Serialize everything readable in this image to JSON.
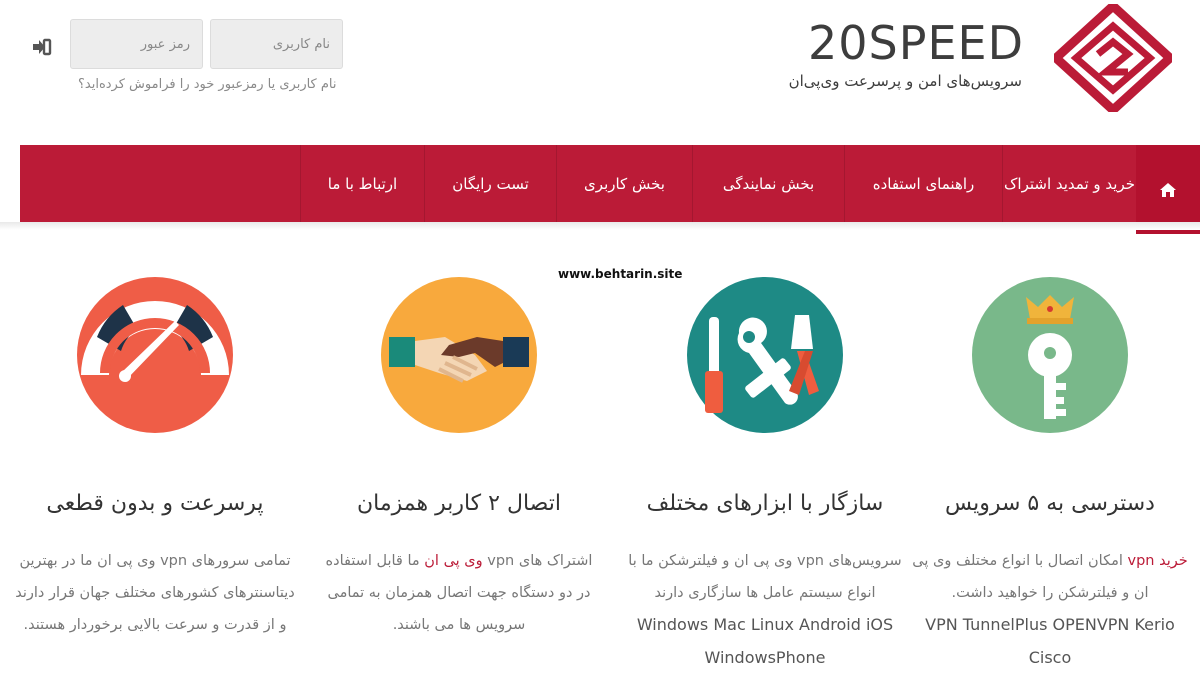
{
  "brand": {
    "logo_text": "20SPEED",
    "tagline": "سرویس‌های امن و پرسرعت وی‌پی‌ان",
    "colors": {
      "primary": "#bb1b37",
      "dark": "#3d3d3d"
    }
  },
  "login": {
    "username_placeholder": "نام کاربری",
    "password_placeholder": "رمز عبور",
    "submit_icon": "sign-in-icon",
    "forgot_text": "نام کاربری یا رمزعبور خود را فراموش کرده‌اید؟"
  },
  "nav": {
    "home_icon": "home-icon",
    "items": [
      {
        "label": "خرید و تمدید اشتراک"
      },
      {
        "label": "راهنمای استفاده"
      },
      {
        "label": "بخش نمایندگی"
      },
      {
        "label": "بخش کاربری"
      },
      {
        "label": "تست رایگان"
      },
      {
        "label": "ارتباط با ما"
      }
    ]
  },
  "watermark": "www.behtarin.site",
  "features": [
    {
      "icon": "key-crown-icon",
      "title": "دسترسی به ۵ سرویس",
      "desc_link": "خرید vpn",
      "desc_1": " امکان اتصال با انواع مختلف وی پی ان و فیلترشکن را خواهید داشت.",
      "desc_en": "VPN TunnelPlus OPENVPN Kerio Cisco"
    },
    {
      "icon": "tools-icon",
      "title": "سازگار با ابزارهای مختلف",
      "desc_1": "سرویس‌های vpn وی پی ان و فیلترشکن ما با انواع سیستم عامل ها سازگاری دارند",
      "desc_en": "Windows Mac Linux Android iOS WindowsPhone"
    },
    {
      "icon": "handshake-icon",
      "title": "اتصال ۲ کاربر همزمان",
      "desc_1": "اشتراک های vpn ",
      "desc_link": "وی پی ان",
      "desc_2": " ما قابل استفاده در دو دستگاه جهت اتصال همزمان به تمامی سرویس ها می باشند."
    },
    {
      "icon": "speedometer-icon",
      "title": "پرسرعت و بدون قطعی",
      "desc_1": "تمامی سرورهای vpn وی پی ان ما در بهترین دیتاسنترهای کشورهای مختلف جهان قرار دارند و از قدرت و سرعت بالایی برخوردار هستند."
    }
  ]
}
